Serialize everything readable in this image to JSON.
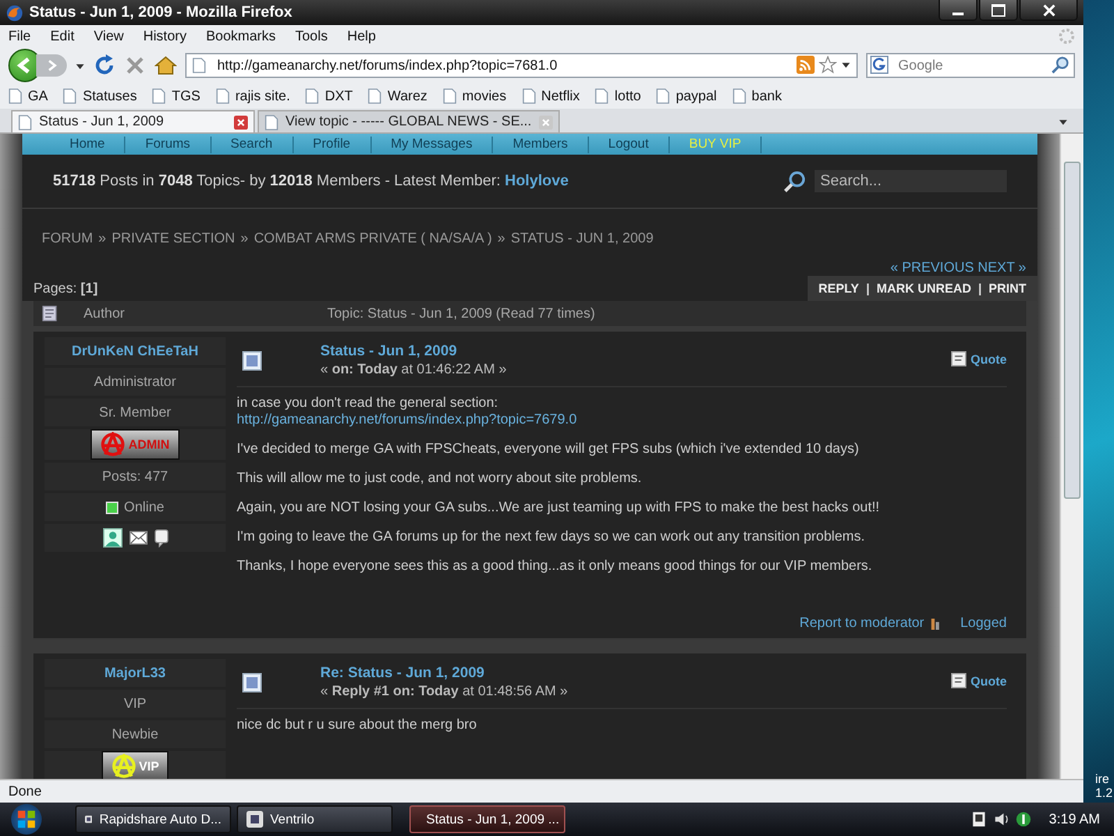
{
  "window": {
    "title": "Status - Jun 1, 2009 - Mozilla Firefox"
  },
  "menu": [
    "File",
    "Edit",
    "View",
    "History",
    "Bookmarks",
    "Tools",
    "Help"
  ],
  "address": {
    "value": "http://gameanarchy.net/forums/index.php?topic=7681.0"
  },
  "web_search": {
    "placeholder": "Google"
  },
  "bookmarks": [
    "GA",
    "Statuses",
    "TGS",
    "rajis site.",
    "DXT",
    "Warez",
    "movies",
    "Netflix",
    "lotto",
    "paypal",
    "bank"
  ],
  "tabs": [
    {
      "label": "Status - Jun 1, 2009",
      "selected": true
    },
    {
      "label": "View topic - ----- GLOBAL NEWS - SE...",
      "selected": false
    }
  ],
  "forum": {
    "nav": [
      {
        "label": "Home",
        "color": "#103f55"
      },
      {
        "label": "Forums",
        "color": "#103f55"
      },
      {
        "label": "Search",
        "color": "#103f55"
      },
      {
        "label": "Profile",
        "color": "#103f55"
      },
      {
        "label": "My Messages",
        "color": "#103f55"
      },
      {
        "label": "Members",
        "color": "#103f55"
      },
      {
        "label": "Logout",
        "color": "#103f55"
      },
      {
        "label": "BUY VIP",
        "color": "#e8f040"
      }
    ],
    "stats": "**51718** Posts in **7048** Topics- by **12018** Members - Latest Member: ",
    "latest_member": "Holylove",
    "search": {
      "placeholder": "Search..."
    },
    "breadcrumb": [
      "FORUM",
      "PRIVATE SECTION",
      "COMBAT ARMS PRIVATE ( NA/SA/A )",
      "STATUS - JUN 1, 2009"
    ],
    "breadcrumb_separator": "»",
    "prev_next": "« PREVIOUS NEXT »",
    "pages": "Pages: **[1]**",
    "actions": [
      "REPLY",
      "MARK UNREAD",
      "PRINT"
    ],
    "action_separator": "|",
    "header": {
      "author": "Author",
      "topic": "Topic: Status - Jun 1, 2009  (Read 77 times)"
    },
    "posts": [
      {
        "author": "DrUnKeN ChEeTaH",
        "group": "Administrator",
        "rank": "Sr. Member",
        "badge": "ADMIN",
        "posts": "Posts: 477",
        "status": "Online",
        "title": "Status - Jun 1, 2009",
        "meta": "« **on: Today** at 01:46:22 AM »",
        "quote": "Quote",
        "body": [
          {
            "kind": "text",
            "text": "in case you don't read the general section:"
          },
          {
            "kind": "link",
            "text": "http://gameanarchy.net/forums/index.php?topic=7679.0"
          },
          {
            "kind": "text",
            "text": "I've decided to merge GA with FPSCheats, everyone will get FPS subs (which i've extended 10 days)"
          },
          {
            "kind": "text",
            "text": "This will allow me to just code, and not worry about site problems."
          },
          {
            "kind": "text",
            "text": "Again, you are NOT losing your GA subs...We are just teaming up with FPS to make the best hacks out!!"
          },
          {
            "kind": "text",
            "text": "I'm going to leave the GA forums up for the next few days so we can work out any transition problems."
          },
          {
            "kind": "text",
            "text": "Thanks, I hope everyone sees this as a good thing...as it only means good things for our VIP members."
          }
        ],
        "report": "Report to moderator",
        "logged": "Logged"
      },
      {
        "author": "MajorL33",
        "group": "VIP",
        "rank": "Newbie",
        "badge": "VIP",
        "title": "Re: Status - Jun 1, 2009",
        "meta": "« **Reply #1 on: Today** at 01:48:56 AM »",
        "quote": "Quote",
        "body": [
          {
            "kind": "text",
            "text": "nice dc but r u sure about the merg bro"
          }
        ]
      }
    ]
  },
  "status_bar": "Done",
  "taskbar": [
    {
      "label": "Rapidshare Auto D...",
      "selected": false
    },
    {
      "label": "Ventrilo",
      "selected": false
    },
    {
      "label": "Status - Jun 1, 2009 ...",
      "selected": true
    }
  ],
  "clock": "3:19 AM",
  "desktop_text": [
    "ire",
    "1.2"
  ]
}
